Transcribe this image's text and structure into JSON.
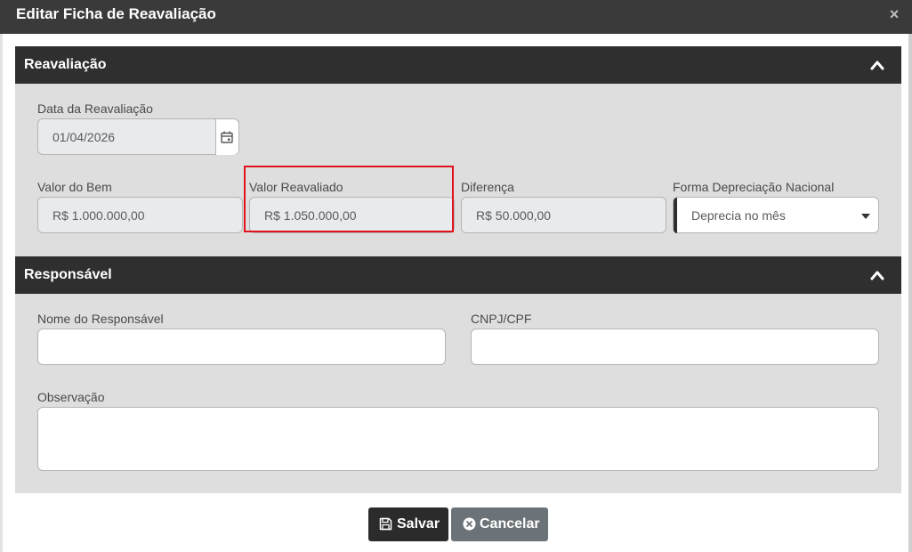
{
  "modal": {
    "title": "Editar Ficha de Reavaliação",
    "close_icon": "×"
  },
  "section_reavaliacao": {
    "title": "Reavaliação",
    "data_label": "Data da Reavaliação",
    "data_value": "01/04/2026",
    "valor_bem_label": "Valor do Bem",
    "valor_bem_value": "R$ 1.000.000,00",
    "valor_reavaliado_label": "Valor Reavaliado",
    "valor_reavaliado_value": "R$ 1.050.000,00",
    "diferenca_label": "Diferença",
    "diferenca_value": "R$ 50.000,00",
    "forma_label": "Forma Depreciação Nacional",
    "forma_value": "Deprecia no mês"
  },
  "section_responsavel": {
    "title": "Responsável",
    "nome_label": "Nome do Responsável",
    "nome_value": "",
    "cnpj_label": "CNPJ/CPF",
    "cnpj_value": "",
    "obs_label": "Observação",
    "obs_value": ""
  },
  "footer": {
    "save_label": "Salvar",
    "cancel_label": "Cancelar"
  },
  "colors": {
    "header_bg": "#3a3a3a",
    "section_bg": "#2f2f2f",
    "body_bg": "#dedede",
    "highlight": "#e0141b",
    "cancel_bg": "#6c7378"
  }
}
